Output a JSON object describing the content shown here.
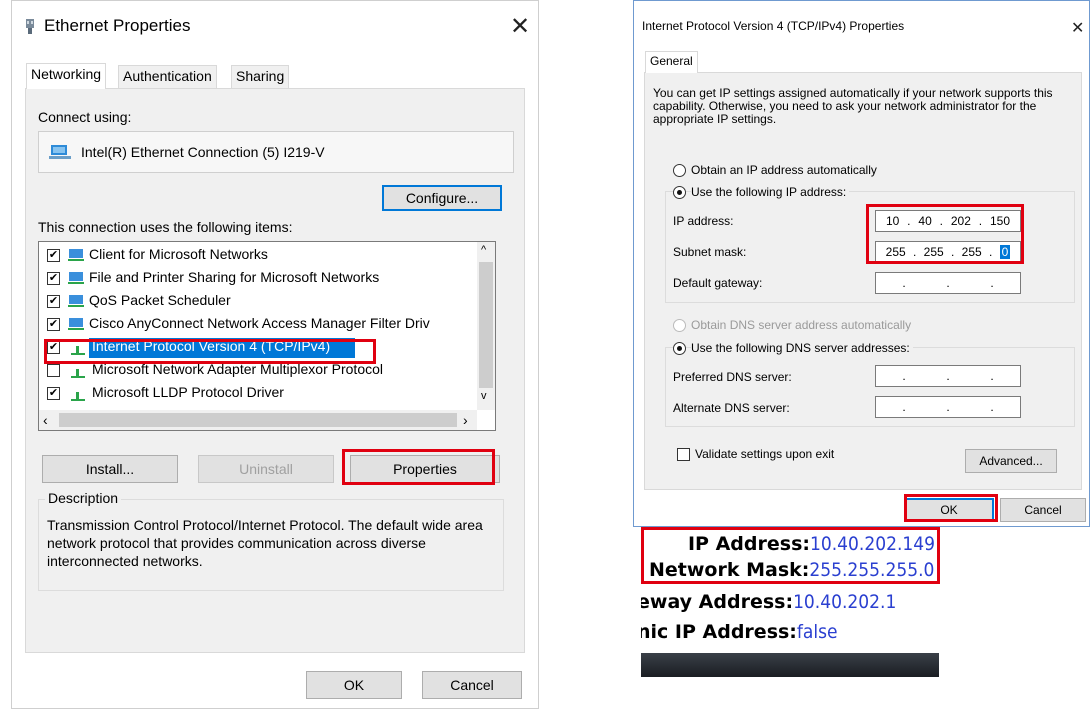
{
  "ethernet": {
    "title": "Ethernet Properties",
    "tabs": [
      "Networking",
      "Authentication",
      "Sharing"
    ],
    "connect_using_label": "Connect using:",
    "adapter_name": "Intel(R) Ethernet Connection (5) I219-V",
    "configure_label": "Configure...",
    "items_label": "This connection uses the following items:",
    "items": [
      {
        "label": "Client for Microsoft Networks",
        "checked": true
      },
      {
        "label": "File and Printer Sharing for Microsoft Networks",
        "checked": true
      },
      {
        "label": "QoS Packet Scheduler",
        "checked": true
      },
      {
        "label": "Cisco AnyConnect Network Access Manager Filter Driv",
        "checked": true
      },
      {
        "label": "Internet Protocol Version 4 (TCP/IPv4)",
        "checked": true,
        "selected": true
      },
      {
        "label": "Microsoft Network Adapter Multiplexor Protocol",
        "checked": false
      },
      {
        "label": "Microsoft LLDP Protocol Driver",
        "checked": true
      }
    ],
    "install_label": "Install...",
    "uninstall_label": "Uninstall",
    "properties_label": "Properties",
    "description_label": "Description",
    "description_text": "Transmission Control Protocol/Internet Protocol. The default wide area network protocol that provides communication across diverse interconnected networks.",
    "ok_label": "OK",
    "cancel_label": "Cancel"
  },
  "ipv4": {
    "title": "Internet Protocol Version 4 (TCP/IPv4) Properties",
    "tab": "General",
    "intro": "You can get IP settings assigned automatically if your network supports this capability. Otherwise, you need to ask your network administrator for the appropriate IP settings.",
    "obtain_auto_label": "Obtain an IP address automatically",
    "use_following_label": "Use the following IP address:",
    "ip_label": "IP address:",
    "ip_octets": [
      "10",
      "40",
      "202",
      "150"
    ],
    "subnet_label": "Subnet mask:",
    "subnet_octets": [
      "255",
      "255",
      "255",
      "0"
    ],
    "gateway_label": "Default gateway:",
    "obtain_dns_label": "Obtain DNS server address automatically",
    "use_dns_label": "Use the following DNS server addresses:",
    "preferred_dns_label": "Preferred DNS server:",
    "alternate_dns_label": "Alternate DNS server:",
    "validate_label": "Validate settings upon exit",
    "advanced_label": "Advanced...",
    "ok_label": "OK",
    "cancel_label": "Cancel"
  },
  "device_info": {
    "ip_key": "IP Address:",
    "ip_val": "10.40.202.149",
    "mask_key": "Network Mask:",
    "mask_val": "255.255.255.0",
    "gw_key": "eway Address:",
    "gw_val": "10.40.202.1",
    "dyn_key": "nic IP Address:",
    "dyn_val": "false"
  },
  "colors": {
    "highlight_box": "#e00010",
    "selection": "#0078d7",
    "value_blue": "#2a3fd0"
  }
}
